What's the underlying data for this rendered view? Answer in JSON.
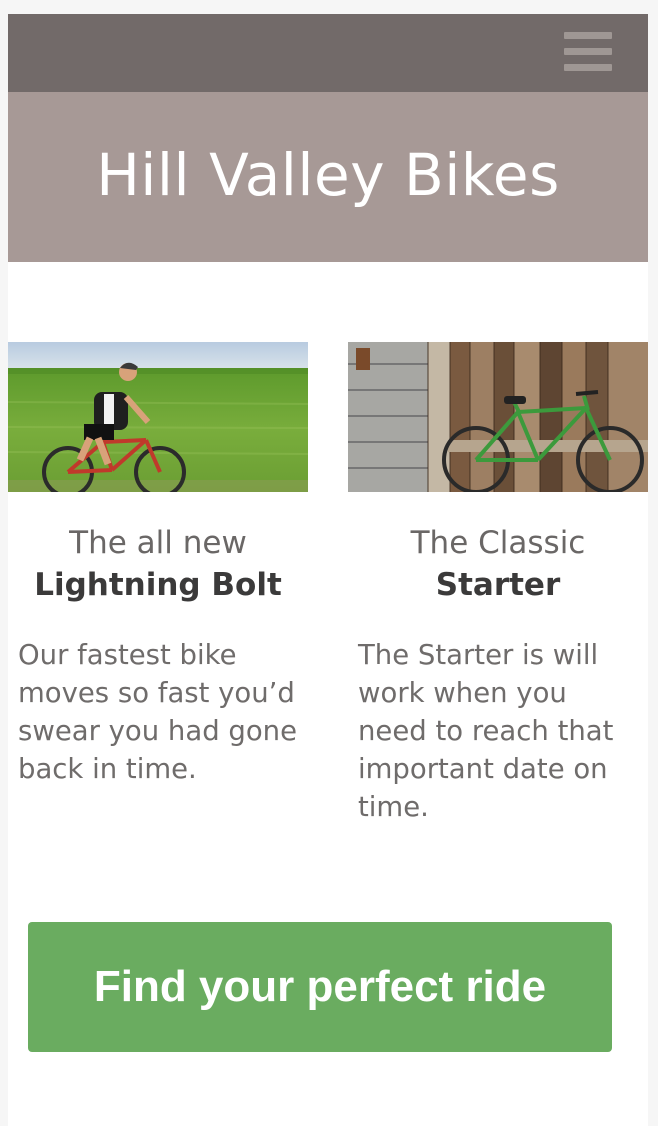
{
  "header": {
    "menu_icon": "hamburger-menu-icon",
    "title": "Hill Valley Bikes"
  },
  "products": [
    {
      "photo": "cyclist-on-mountain-bike-photo",
      "subtitle": "The all new",
      "name": "Lightning Bolt",
      "description": "Our fastest bike moves so fast you’d swear you had gone back in time."
    },
    {
      "photo": "green-bike-against-wooden-wall-photo",
      "subtitle": "The Classic",
      "name": "Starter",
      "description": "The Starter is will work when you need to reach that important date on time."
    }
  ],
  "cta": {
    "label": "Find your perfect ride"
  },
  "colors": {
    "topbar": "#726a69",
    "hero": "#a79996",
    "cta": "#6aac60"
  }
}
